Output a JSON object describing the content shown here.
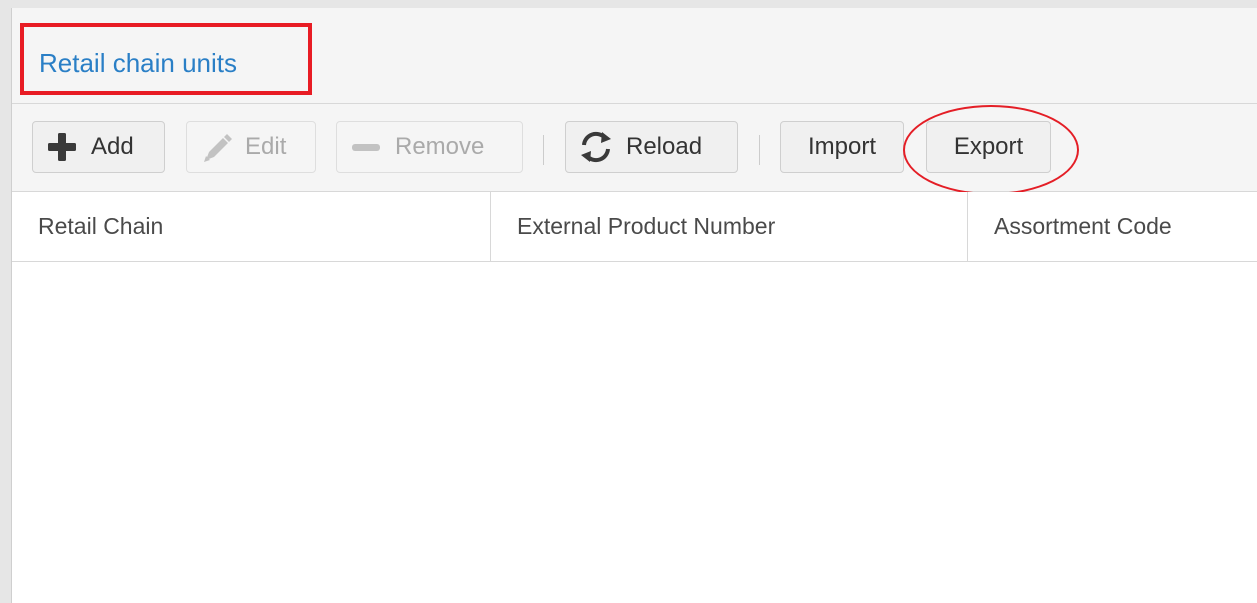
{
  "panel": {
    "title": "Retail chain units"
  },
  "toolbar": {
    "add_label": "Add",
    "edit_label": "Edit",
    "remove_label": "Remove",
    "reload_label": "Reload",
    "import_label": "Import",
    "export_label": "Export"
  },
  "icons": {
    "add": "plus-icon",
    "edit": "pencil-icon",
    "remove": "minus-icon",
    "reload": "refresh-icon"
  },
  "grid": {
    "columns": [
      "Retail Chain",
      "External Product Number",
      "Assortment Code"
    ],
    "rows": []
  },
  "colors": {
    "title": "#2a7fc6",
    "annotation": "#e81c24"
  }
}
